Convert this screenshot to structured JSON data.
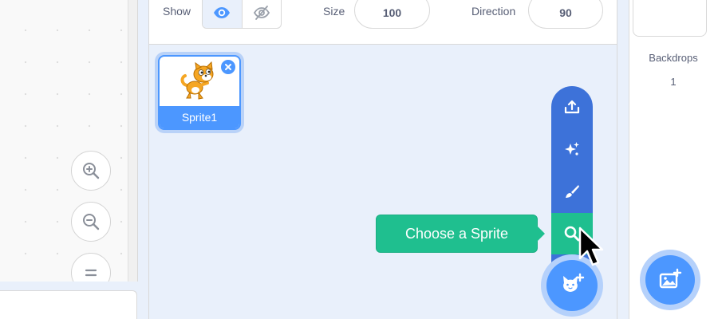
{
  "sprite_info": {
    "show_label": "Show",
    "show_visible_icon": "eye-icon",
    "show_hidden_icon": "eye-slash-icon",
    "size_label": "Size",
    "size_value": "100",
    "direction_label": "Direction",
    "direction_value": "90"
  },
  "code_area": {
    "zoom_in_icon": "zoom-in-icon",
    "zoom_out_icon": "zoom-out-icon",
    "zoom_reset_icon": "zoom-reset-icon"
  },
  "sprites": [
    {
      "name": "Sprite1",
      "icon": "cat-sprite-icon",
      "selected": true
    }
  ],
  "add_sprite_menu": {
    "items": [
      {
        "name": "upload",
        "icon": "upload-icon"
      },
      {
        "name": "surprise",
        "icon": "sparkle-icon"
      },
      {
        "name": "paint",
        "icon": "brush-icon"
      },
      {
        "name": "choose",
        "icon": "search-icon",
        "highlighted": true
      }
    ],
    "main_icon": "cat-plus-icon",
    "tooltip": "Choose a Sprite"
  },
  "stage_pane": {
    "backdrops_label": "Backdrops",
    "backdrops_count": "1",
    "add_backdrop_icon": "image-plus-icon"
  },
  "colors": {
    "accent": "#4c97ff",
    "menu": "#3d72d9",
    "highlight": "#1fbf8f",
    "text": "#575e75"
  }
}
